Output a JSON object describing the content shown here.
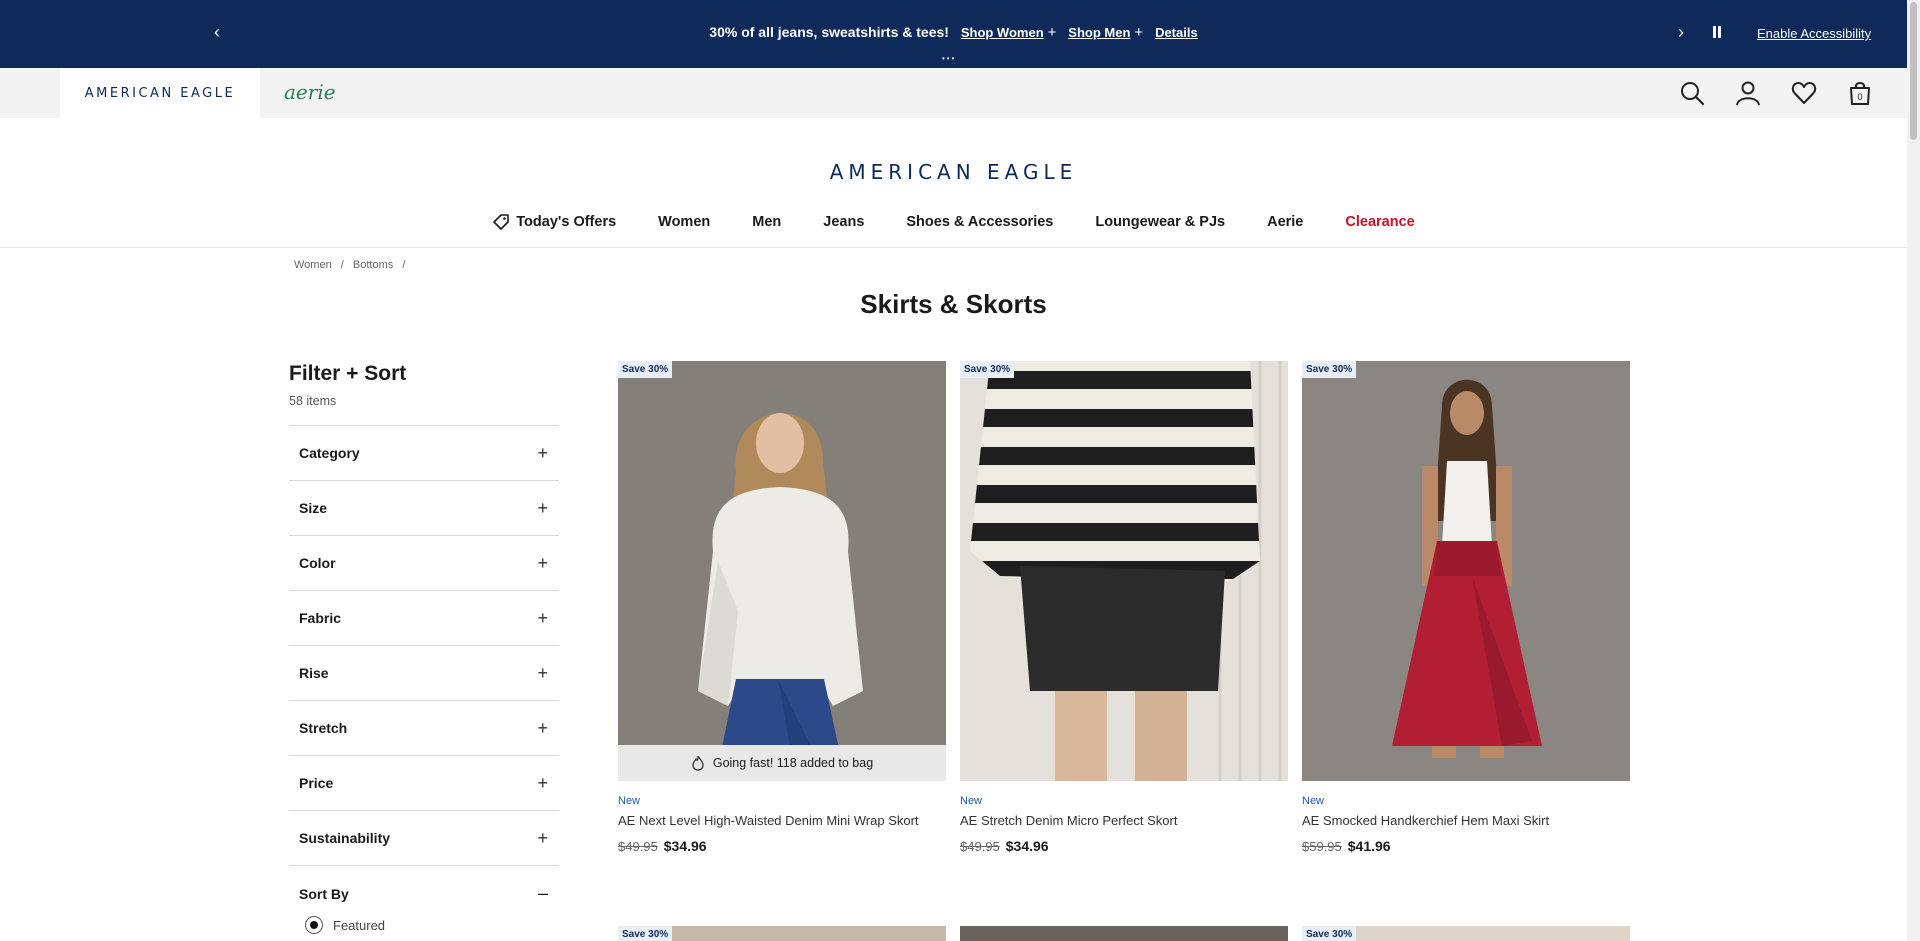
{
  "promo": {
    "message": "30% of all jeans, sweatshirts & tees!",
    "links": [
      "Shop Women",
      "Shop Men",
      "Details"
    ],
    "accessibility": "Enable Accessibility"
  },
  "brands": {
    "ae": "AMERICAN EAGLE",
    "aerie": "aerie"
  },
  "header_icons": [
    "search-icon",
    "account-icon",
    "heart-icon",
    "bag-icon"
  ],
  "bag_count": "0",
  "logo": "AMERICAN EAGLE",
  "nav": [
    "Today's Offers",
    "Women",
    "Men",
    "Jeans",
    "Shoes & Accessories",
    "Loungewear & PJs",
    "Aerie",
    "Clearance"
  ],
  "breadcrumb": [
    "Women",
    "/",
    "Bottoms",
    "/"
  ],
  "page_title": "Skirts & Skorts",
  "filter": {
    "title": "Filter + Sort",
    "count": "58 items",
    "facets": [
      "Category",
      "Size",
      "Color",
      "Fabric",
      "Rise",
      "Stretch",
      "Price",
      "Sustainability"
    ],
    "sort_label": "Sort By",
    "sort_option": "Featured"
  },
  "products": [
    {
      "badge": "Save 30%",
      "flag": "New",
      "name": "AE Next Level High-Waisted Denim Mini Wrap Skort",
      "was": "$49.95",
      "now": "$34.96",
      "going": "Going fast! 118 added to bag"
    },
    {
      "badge": "Save 30%",
      "flag": "New",
      "name": "AE Stretch Denim Micro Perfect Skort",
      "was": "$49.95",
      "now": "$34.96"
    },
    {
      "badge": "Save 30%",
      "flag": "New",
      "name": "AE Smocked Handkerchief Hem Maxi Skirt",
      "was": "$59.95",
      "now": "$41.96"
    }
  ],
  "row2_badges": [
    "Save 30%",
    "Save 30%"
  ],
  "colors": {
    "navy": "#0f2a5a",
    "clearance": "#c8102e",
    "aerie": "#2f7d5a"
  }
}
